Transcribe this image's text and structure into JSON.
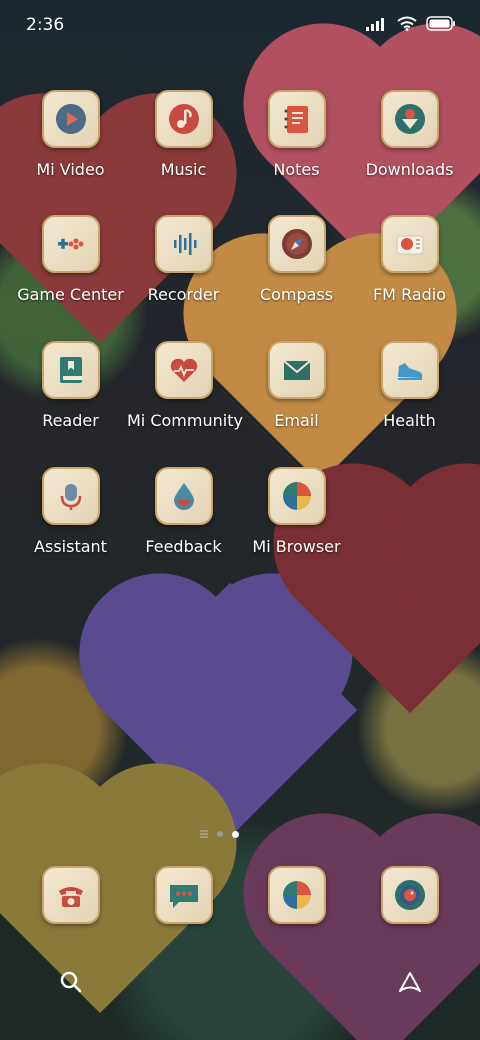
{
  "status_bar": {
    "time": "2:36"
  },
  "apps": [
    {
      "label": "Mi Video",
      "icon": "play-icon"
    },
    {
      "label": "Music",
      "icon": "music-note-icon"
    },
    {
      "label": "Notes",
      "icon": "notebook-icon"
    },
    {
      "label": "Downloads",
      "icon": "download-arrow-icon"
    },
    {
      "label": "Game Center",
      "icon": "gamepad-icon"
    },
    {
      "label": "Recorder",
      "icon": "soundwave-icon"
    },
    {
      "label": "Compass",
      "icon": "compass-icon"
    },
    {
      "label": "FM Radio",
      "icon": "radio-icon"
    },
    {
      "label": "Reader",
      "icon": "book-icon"
    },
    {
      "label": "Mi Community",
      "icon": "heart-pulse-icon"
    },
    {
      "label": "Email",
      "icon": "envelope-icon"
    },
    {
      "label": "Health",
      "icon": "shoe-icon"
    },
    {
      "label": "Assistant",
      "icon": "microphone-icon"
    },
    {
      "label": "Feedback",
      "icon": "water-drop-icon"
    },
    {
      "label": "Mi Browser",
      "icon": "pie-icon"
    }
  ],
  "dock": [
    {
      "name": "Phone",
      "icon": "telephone-icon"
    },
    {
      "name": "Messages",
      "icon": "chat-bubble-icon"
    },
    {
      "name": "Browser",
      "icon": "pie-icon"
    },
    {
      "name": "Camera",
      "icon": "camera-lens-icon"
    }
  ],
  "page_indicator": {
    "pages": 2,
    "current": 2
  },
  "colors": {
    "tile": "#efe3cb",
    "tile_border": "#c8a56a",
    "accent_red": "#c94a40",
    "accent_teal": "#2f7a73"
  }
}
